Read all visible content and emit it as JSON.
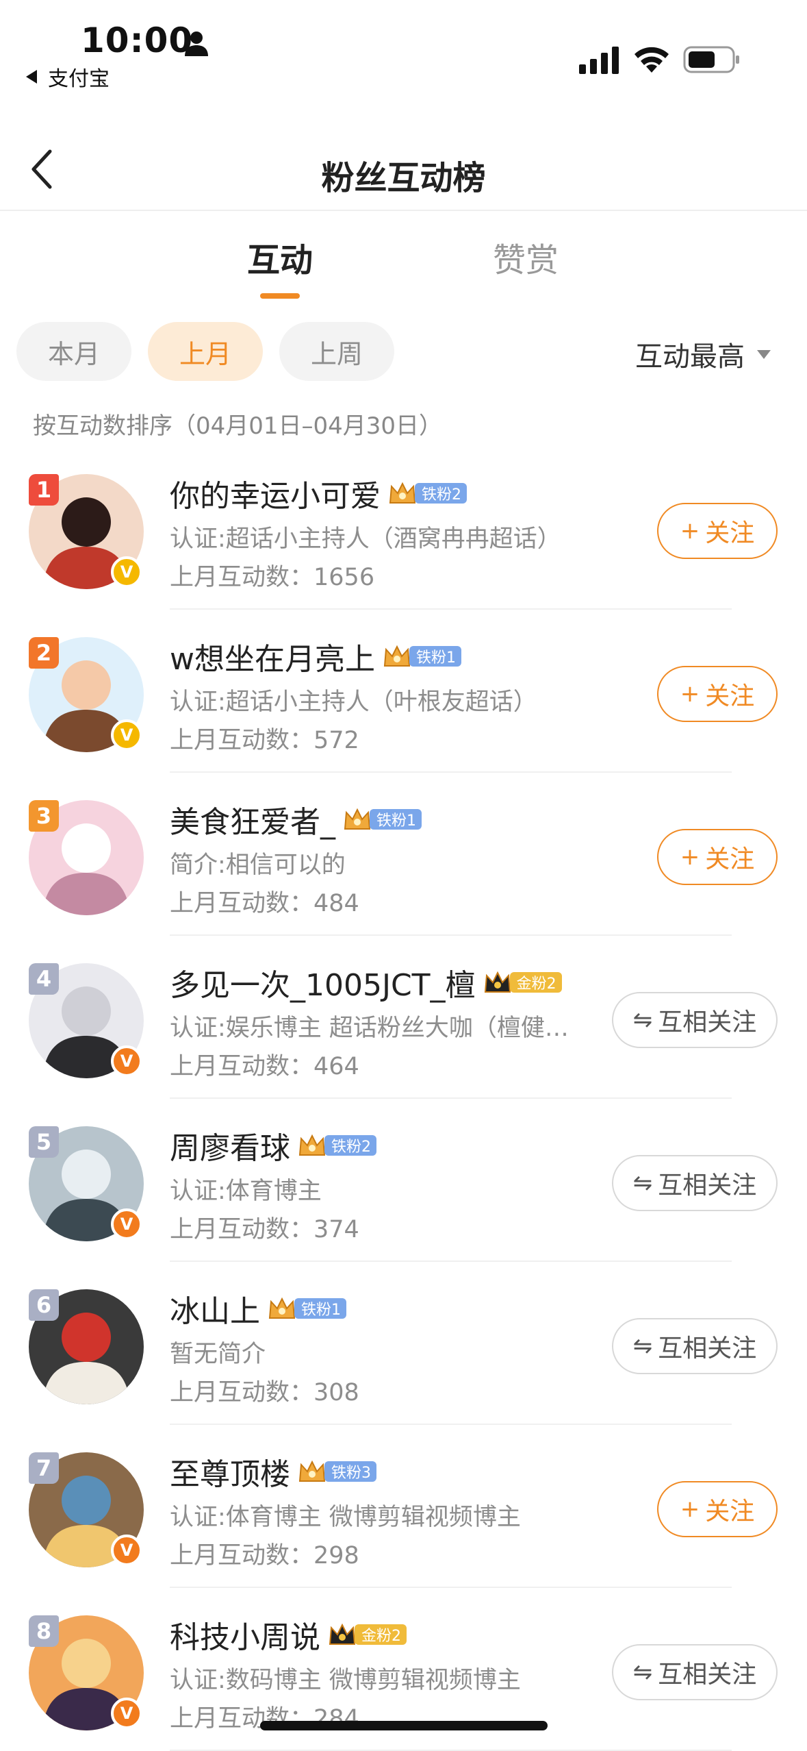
{
  "status_bar": {
    "time": "10:00",
    "back_app": "支付宝"
  },
  "nav": {
    "title": "粉丝互动榜"
  },
  "tabs": [
    {
      "label": "互动",
      "active": true
    },
    {
      "label": "赞赏",
      "active": false
    }
  ],
  "filters": {
    "chips": [
      {
        "label": "本月",
        "selected": false
      },
      {
        "label": "上月",
        "selected": true
      },
      {
        "label": "上周",
        "selected": false
      }
    ],
    "sort_label": "互动最高"
  },
  "range_note": "按互动数排序（04月01日–04月30日）",
  "fans": [
    {
      "rank": "1",
      "name": "你的幸运小可爱",
      "level": "铁粉2",
      "level_type": "iron",
      "desc": "认证:超话小主持人（酒窝冉冉超话）",
      "count_label": "上月互动数：",
      "count": "1656",
      "button": "关注",
      "button_type": "follow",
      "verify": "yellow"
    },
    {
      "rank": "2",
      "name": "w想坐在月亮上",
      "level": "铁粉1",
      "level_type": "iron",
      "desc": "认证:超话小主持人（叶根友超话）",
      "count_label": "上月互动数：",
      "count": "572",
      "button": "关注",
      "button_type": "follow",
      "verify": "yellow"
    },
    {
      "rank": "3",
      "name": "美食狂爱者_",
      "level": "铁粉1",
      "level_type": "iron",
      "desc": "简介:相信可以的",
      "count_label": "上月互动数：",
      "count": "484",
      "button": "关注",
      "button_type": "follow",
      "verify": ""
    },
    {
      "rank": "4",
      "name": "多见一次_1005JCT_檀",
      "level": "金粉2",
      "level_type": "gold",
      "desc": "认证:娱乐博主 超话粉丝大咖（檀健…",
      "count_label": "上月互动数：",
      "count": "464",
      "button": "互相关注",
      "button_type": "mutual",
      "verify": "orange"
    },
    {
      "rank": "5",
      "name": "周廖看球",
      "level": "铁粉2",
      "level_type": "iron",
      "desc": "认证:体育博主",
      "count_label": "上月互动数：",
      "count": "374",
      "button": "互相关注",
      "button_type": "mutual",
      "verify": "orange"
    },
    {
      "rank": "6",
      "name": "冰山上",
      "level": "铁粉1",
      "level_type": "iron",
      "desc": "暂无简介",
      "count_label": "上月互动数：",
      "count": "308",
      "button": "互相关注",
      "button_type": "mutual",
      "verify": ""
    },
    {
      "rank": "7",
      "name": "至尊顶楼",
      "level": "铁粉3",
      "level_type": "iron",
      "desc": "认证:体育博主 微博剪辑视频博主",
      "count_label": "上月互动数：",
      "count": "298",
      "button": "关注",
      "button_type": "follow",
      "verify": "orange"
    },
    {
      "rank": "8",
      "name": "科技小周说",
      "level": "金粉2",
      "level_type": "gold",
      "desc": "认证:数码博主 微博剪辑视频博主",
      "count_label": "上月互动数：",
      "count": "284",
      "button": "互相关注",
      "button_type": "mutual",
      "verify": "orange"
    }
  ],
  "colors": {
    "accent": "#f08a24",
    "rank_top": [
      "#ee4c3c",
      "#f2762a",
      "#f3962e"
    ],
    "rank_other": "#a9afc4"
  }
}
